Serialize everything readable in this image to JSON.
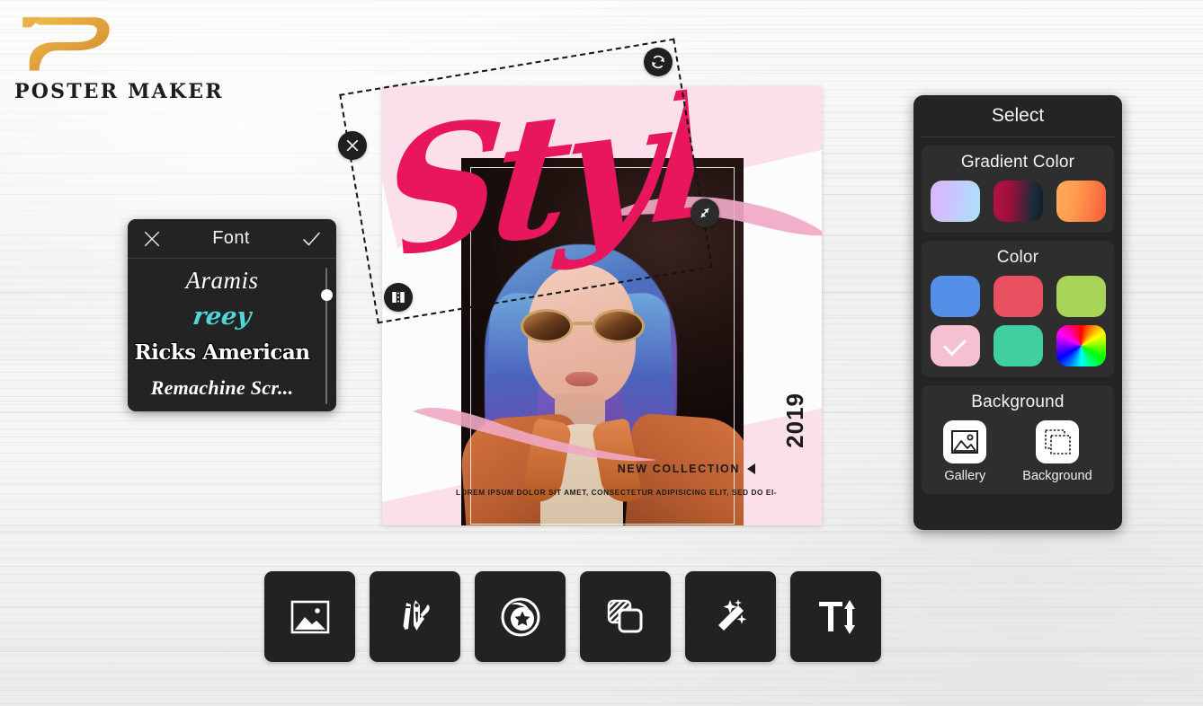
{
  "app": {
    "logo_text": "POSTER MAKER",
    "logo_icon": "stylized-p-logo"
  },
  "poster": {
    "headline": "Stylish",
    "year": "2019",
    "new_collection": "NEW COLLECTION",
    "body_text": "LOREM IPSUM DOLOR SIT AMET, CONSECTETUR ADIPISICING ELIT, SED DO EI-",
    "headline_color": "#e8175d",
    "accent_pink": "#fbe0ec",
    "brush_pink": "#f0a8c4"
  },
  "selection": {
    "handles": [
      {
        "name": "rotate-handle",
        "icon": "rotate-icon"
      },
      {
        "name": "delete-handle",
        "icon": "close-icon"
      },
      {
        "name": "flip-handle",
        "icon": "mirror-flip-icon"
      },
      {
        "name": "resize-handle",
        "icon": "resize-diagonal-icon"
      }
    ]
  },
  "font_panel": {
    "title": "Font",
    "close_icon": "close-icon",
    "confirm_icon": "check-icon",
    "fonts": [
      {
        "label": "Aramis",
        "style": "f-aramis",
        "selected": false
      },
      {
        "label": "reey",
        "style": "f-reey",
        "selected": true
      },
      {
        "label": "Ricks American",
        "style": "f-ricks",
        "selected": false
      },
      {
        "label": "Remachine Scr...",
        "style": "f-remachine",
        "selected": false
      }
    ]
  },
  "select_panel": {
    "title": "Select",
    "gradient_section": {
      "title": "Gradient Color",
      "swatches": [
        {
          "name": "gradient-lavender-cyan",
          "css": "linear-gradient(100deg,#dcb6ff 0%,#cfc0ff 35%,#a9e4fb 100%)"
        },
        {
          "name": "gradient-crimson-navy",
          "css": "linear-gradient(95deg,#b8123f 0%,#9d0f3c 35%,#1b2c3a 78%,#0f1d27 100%)"
        },
        {
          "name": "gradient-orange-red",
          "css": "linear-gradient(100deg,#ffab5e 0%,#ff9a4e 40%,#fa5b3c 100%)"
        }
      ]
    },
    "color_section": {
      "title": "Color",
      "swatches": [
        {
          "name": "color-blue",
          "css": "#5490e8",
          "selected": false
        },
        {
          "name": "color-red",
          "css": "#e8505f",
          "selected": false
        },
        {
          "name": "color-green",
          "css": "#a8d45a",
          "selected": false
        },
        {
          "name": "color-pink",
          "css": "#f5c0d0",
          "selected": true
        },
        {
          "name": "color-mint",
          "css": "#3fcfa0",
          "selected": false
        },
        {
          "name": "color-picker-wheel",
          "css": "conic-gradient(from 0deg,#ff0000,#ffff00,#00ff00,#00ffff,#0000ff,#ff00ff,#ff0000)",
          "selected": false
        }
      ]
    },
    "background_section": {
      "title": "Background",
      "items": [
        {
          "label": "Gallery",
          "icon": "gallery-image-icon"
        },
        {
          "label": "Background",
          "icon": "layered-squares-icon"
        }
      ]
    }
  },
  "toolbar": {
    "buttons": [
      {
        "name": "image-tool",
        "icon": "image-icon"
      },
      {
        "name": "draw-tool",
        "icon": "pen-brush-icon"
      },
      {
        "name": "sticker-tool",
        "icon": "sticker-star-icon"
      },
      {
        "name": "layers-tool",
        "icon": "layers-icon"
      },
      {
        "name": "effects-tool",
        "icon": "magic-wand-icon"
      },
      {
        "name": "text-tool",
        "icon": "text-size-icon"
      }
    ]
  }
}
